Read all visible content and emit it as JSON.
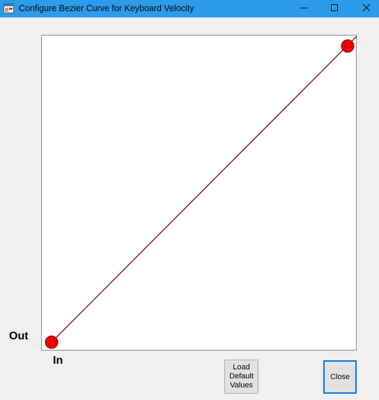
{
  "window": {
    "title": "Configure Bezier Curve for Keyboard Velocity",
    "icon": "app-window-icon",
    "controls": {
      "minimize": "minimize-icon",
      "maximize": "maximize-icon",
      "close": "close-icon"
    }
  },
  "editor": {
    "y_axis_label": "Out",
    "x_axis_label": "In",
    "colors": {
      "curve": "#7a0000",
      "handle_fill": "#ee0000",
      "handle_stroke": "#7a0000",
      "background": "#ffffff"
    }
  },
  "buttons": {
    "load_default": "Load Default Values",
    "close": "Close"
  }
}
